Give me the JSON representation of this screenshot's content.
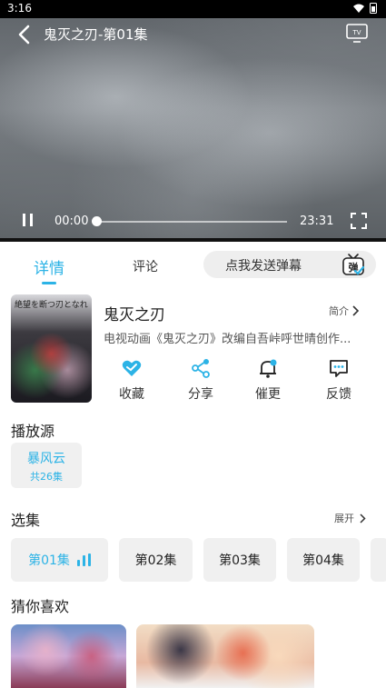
{
  "status_bar": {
    "time": "3:16"
  },
  "player": {
    "title": "鬼灭之刃-第01集",
    "tv_label": "TV",
    "current_time": "00:00",
    "total_time": "23:31",
    "progress": 0
  },
  "tabs": {
    "details": "详情",
    "comments": "评论"
  },
  "danmaku": {
    "placeholder": "点我发送弹幕",
    "icon_text": "弹"
  },
  "anime": {
    "poster_text": "絶望を断つ刃となれ",
    "title": "鬼灭之刃",
    "intro_label": "简介",
    "description": "电视动画《鬼灭之刃》改编自吾峠呼世晴创作..."
  },
  "actions": {
    "favorite": "收藏",
    "share": "分享",
    "urge": "催更",
    "feedback": "反馈"
  },
  "source": {
    "section_title": "播放源",
    "name": "暴风云",
    "count": "共26集"
  },
  "episodes": {
    "section_title": "选集",
    "expand_label": "展开",
    "items": [
      "第01集",
      "第02集",
      "第03集",
      "第04集"
    ]
  },
  "recommend": {
    "section_title": "猜你喜欢"
  },
  "colors": {
    "accent": "#2cb3e6"
  }
}
